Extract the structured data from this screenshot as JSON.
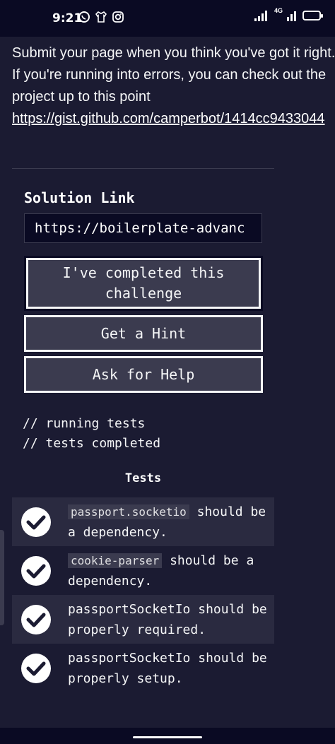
{
  "status_bar": {
    "time": "9:21",
    "left_icons": [
      "whatsapp-icon",
      "shirt-icon",
      "instagram-icon"
    ],
    "network": "4G"
  },
  "intro": {
    "text": "Submit your page when you think you've got it right. If you're running into errors, you can check out the project up to this point",
    "link": "https://gist.github.com/camperbot/1414cc9433044"
  },
  "solution": {
    "label": "Solution Link",
    "value": "https://boilerplate-advanc"
  },
  "buttons": {
    "complete": "I've completed this challenge",
    "hint": "Get a Hint",
    "help": "Ask for Help"
  },
  "console": {
    "line1": "// running tests",
    "line2": "// tests completed"
  },
  "tests": {
    "title": "Tests",
    "items": [
      {
        "code": "passport.socketio",
        "text": " should be a dependency."
      },
      {
        "code": "cookie-parser",
        "text": " should be a dependency."
      },
      {
        "code": "",
        "text": "passportSocketIo should be properly required."
      },
      {
        "code": "",
        "text": "passportSocketIo should be properly setup."
      }
    ]
  },
  "colors": {
    "background": "#1b1b32",
    "dark": "#0a0a23",
    "button": "#3b3b4f",
    "text": "#f5f6f7"
  }
}
